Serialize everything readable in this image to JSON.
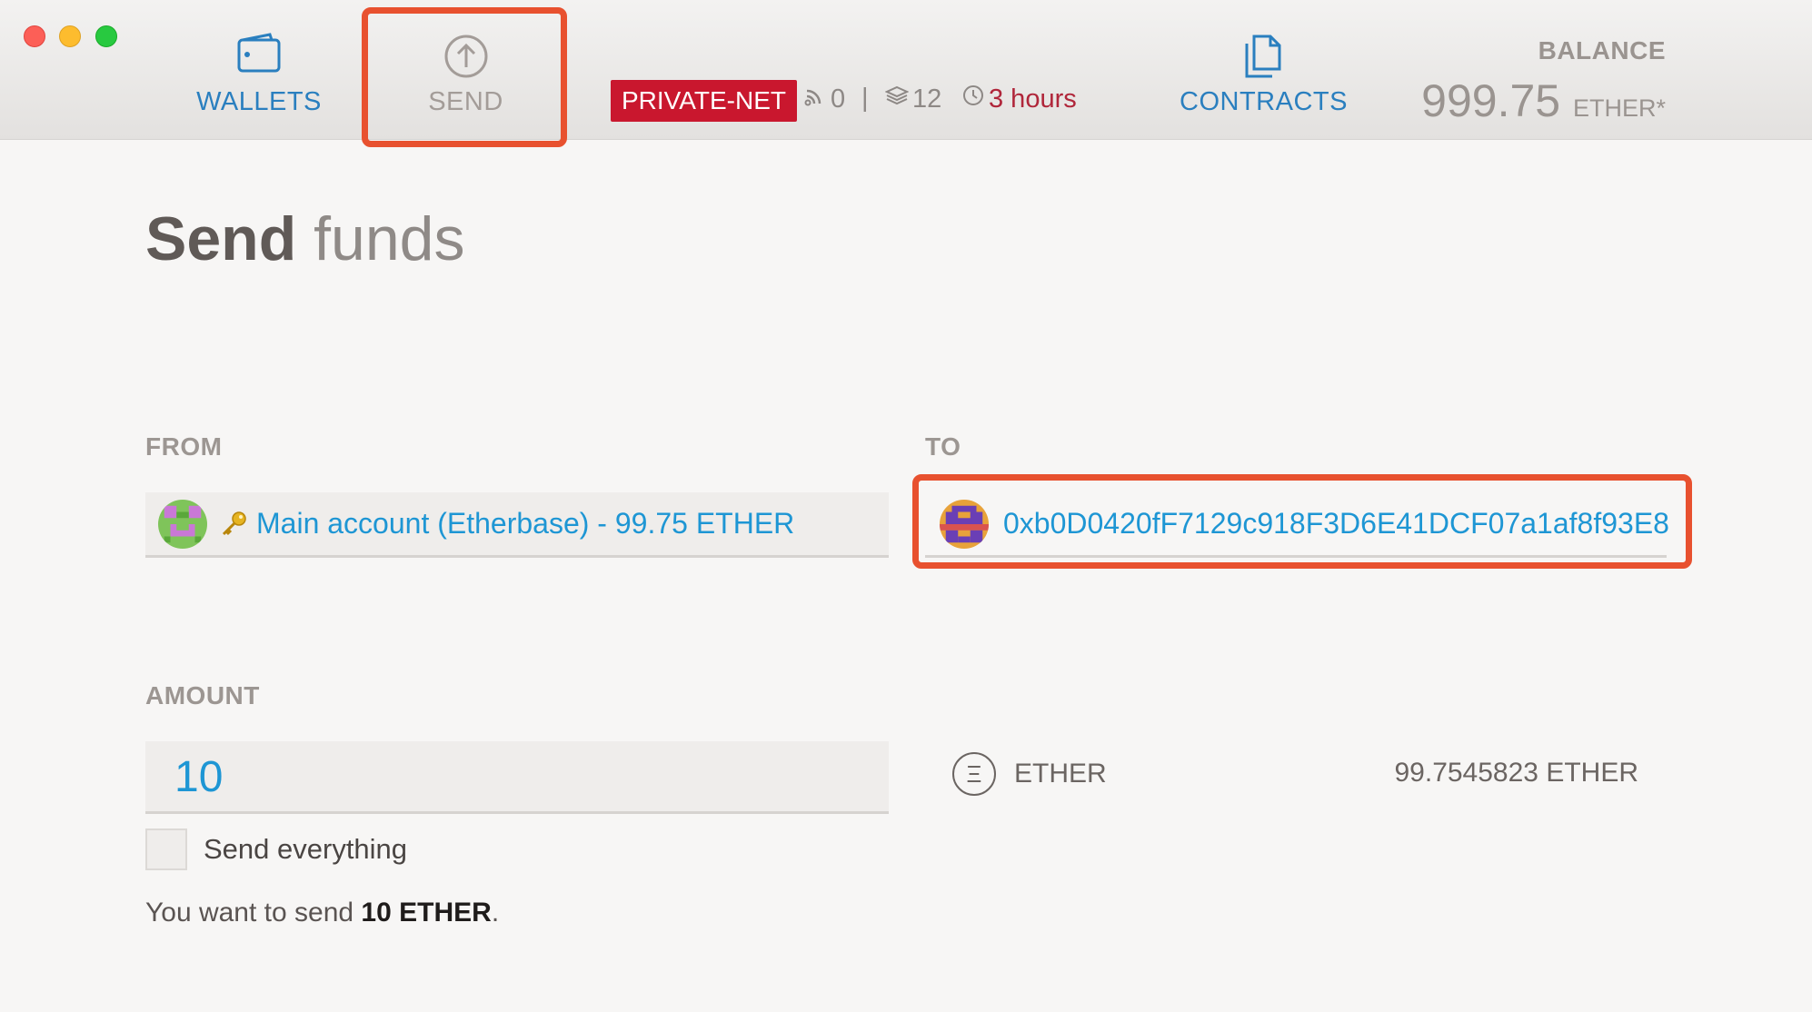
{
  "window": {
    "controls": [
      "close",
      "minimize",
      "zoom"
    ]
  },
  "nav": {
    "wallets": {
      "label": "WALLETS",
      "icon": "wallet-icon"
    },
    "send": {
      "label": "SEND",
      "icon": "arrow-up-circle-icon"
    },
    "contracts": {
      "label": "CONTRACTS",
      "icon": "documents-icon"
    }
  },
  "network": {
    "badge": "PRIVATE-NET",
    "peers": "0",
    "separator": "|",
    "blocks": "12",
    "last_block": "3 hours"
  },
  "balance": {
    "label": "BALANCE",
    "value": "999.75",
    "unit": "ETHER*"
  },
  "page": {
    "title_strong": "Send",
    "title_light": "funds"
  },
  "form": {
    "from_label": "FROM",
    "from_value": "Main account (Etherbase) - 99.75 ETHER",
    "to_label": "TO",
    "to_value": "0xb0D0420fF7129c918F3D6E41DCF07a1af8f93E8",
    "amount_label": "AMOUNT",
    "amount_value": "10",
    "unit_symbol": "Ξ",
    "unit_label": "ETHER",
    "available_balance": "99.7545823 ETHER",
    "send_everything_label": "Send everything",
    "send_everything_checked": false,
    "summary_prefix": "You want to send",
    "summary_amount": "10 ETHER",
    "summary_suffix": "."
  },
  "colors": {
    "accent": "#1e96d4",
    "nav_active": "#2a7fbf",
    "network_badge": "#c9172e",
    "highlight": "#e8512f"
  }
}
